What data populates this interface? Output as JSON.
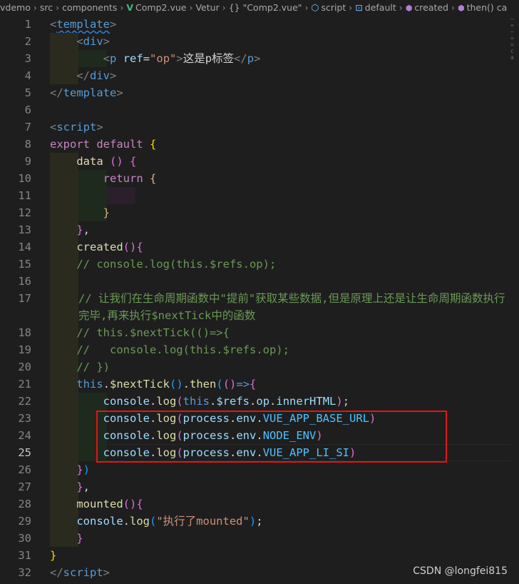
{
  "breadcrumb": {
    "path": [
      "vdemo",
      "src",
      "components"
    ],
    "file": "Comp2.vue",
    "items": [
      "Vetur",
      "{} \"Comp2.vue\"",
      "script",
      "default",
      "created",
      "then() ca"
    ]
  },
  "line_numbers": [
    "1",
    "2",
    "3",
    "4",
    "5",
    "6",
    "7",
    "8",
    "9",
    "10",
    "11",
    "12",
    "13",
    "14",
    "15",
    "16",
    "17",
    "18",
    "19",
    "20",
    "21",
    "22",
    "23",
    "24",
    "25",
    "26",
    "27",
    "28",
    "29",
    "30",
    "31",
    "32"
  ],
  "code": {
    "l1": "template",
    "l2": "div",
    "l3_tag": "p",
    "l3_attr": "ref",
    "l3_val": "\"op\"",
    "l3_text": "这是p标签",
    "l4": "div",
    "l5": "template",
    "l7": "script",
    "l8_kw1": "export",
    "l8_kw2": "default",
    "l9": "data",
    "l10": "return",
    "l14": "created",
    "l15": "// console.log(this.$refs.op);",
    "l17": "// 让我们在生命周期函数中\"提前\"获取某些数据,但是原理上还是让生命周期函数执行完毕,再来执行$nextTick中的函数",
    "l18": "// this.$nextTick(()=>{",
    "l19": "//   console.log(this.$refs.op);",
    "l20": "// })",
    "l21_this": "this",
    "l21_tick": "$nextTick",
    "l21_then": "then",
    "l22_console": "console",
    "l22_log": "log",
    "l22_this": "this",
    "l22_refs": "$refs",
    "l22_op": "op",
    "l22_inner": "innerHTML",
    "process": "process",
    "env": "env",
    "l23_const": "VUE_APP_BASE_URL",
    "l24_const": "NODE_ENV",
    "l25_const": "VUE_APP_LI_SI",
    "l28": "mounted",
    "l29_str": "\"执行了mounted\"",
    "l32": "script"
  },
  "watermark": "CSDN @longfei815",
  "colors": {
    "background": "#1e1e1e",
    "highlight_box": "#e51414"
  }
}
